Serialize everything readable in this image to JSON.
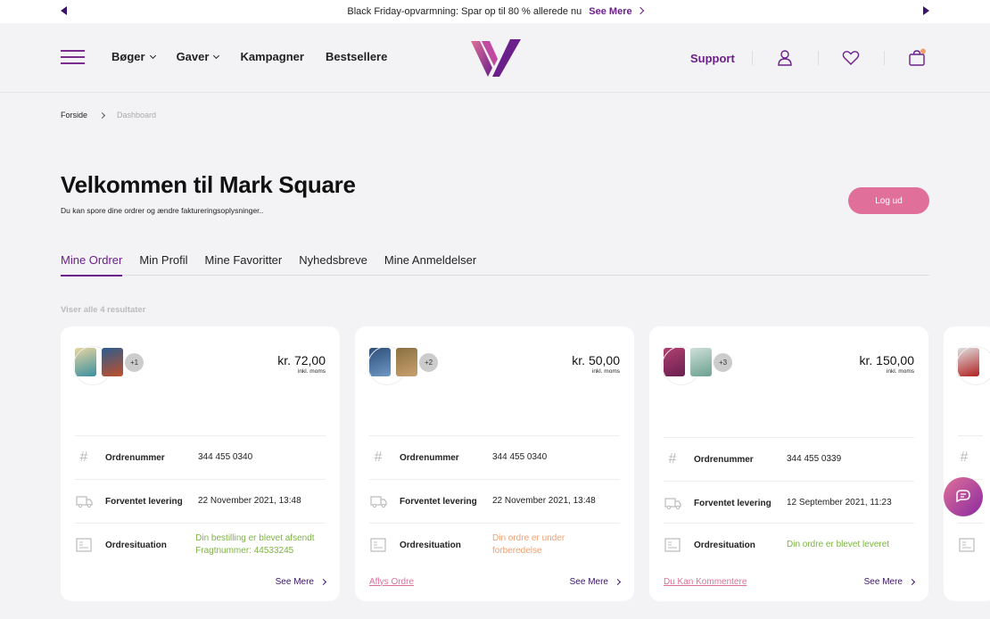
{
  "promo": {
    "text": "Black Friday-opvarmning: Spar op til 80 % allerede nu",
    "more": "See Mere"
  },
  "nav": {
    "items": [
      "Bøger",
      "Gaver",
      "Kampagner",
      "Bestsellere"
    ],
    "support": "Support",
    "cart_count": ""
  },
  "breadcrumb": {
    "home": "Forside",
    "current": "Dashboard"
  },
  "welcome": {
    "title": "Velkommen til Mark Square",
    "subtitle": "Du kan spore dine ordrer og ændre faktureringsoplysninger..",
    "logout": "Log ud"
  },
  "tabs": [
    "Mine Ordrer",
    "Min Profil",
    "Mine Favoritter",
    "Nyhedsbreve",
    "Mine Anmeldelser"
  ],
  "results_text": "Viser alle 4 resultater",
  "labels": {
    "order_number": "Ordrenummer",
    "delivery": "Forventet levering",
    "status": "Ordresituation",
    "vat": "inkl. moms",
    "see_more": "See Mere"
  },
  "orders": [
    {
      "extra": "+1",
      "price": "kr. 72,00",
      "number": "344 455 0340",
      "delivery": "22 November 2021, 13:48",
      "status": "Din bestilling er blevet afsendt Fragtnummer: 44533245",
      "link": ""
    },
    {
      "extra": "+2",
      "price": "kr. 50,00",
      "number": "344 455 0340",
      "delivery": "22 November 2021, 13:48",
      "status": "Din ordre er under forberedelse",
      "link": "Aflys Ordre"
    },
    {
      "extra": "+3",
      "price": "kr. 150,00",
      "number": "344 455 0339",
      "delivery": "12 September 2021, 11:23",
      "status": "Din ordre er blevet leveret",
      "link": "Du Kan Kommentere"
    }
  ],
  "colors": {
    "brand": "#6b1f8a",
    "accent_pink": "#e07099",
    "status_shipped": "#7cb342",
    "status_preparing": "#f0a070",
    "status_delivered": "#7cb342"
  }
}
